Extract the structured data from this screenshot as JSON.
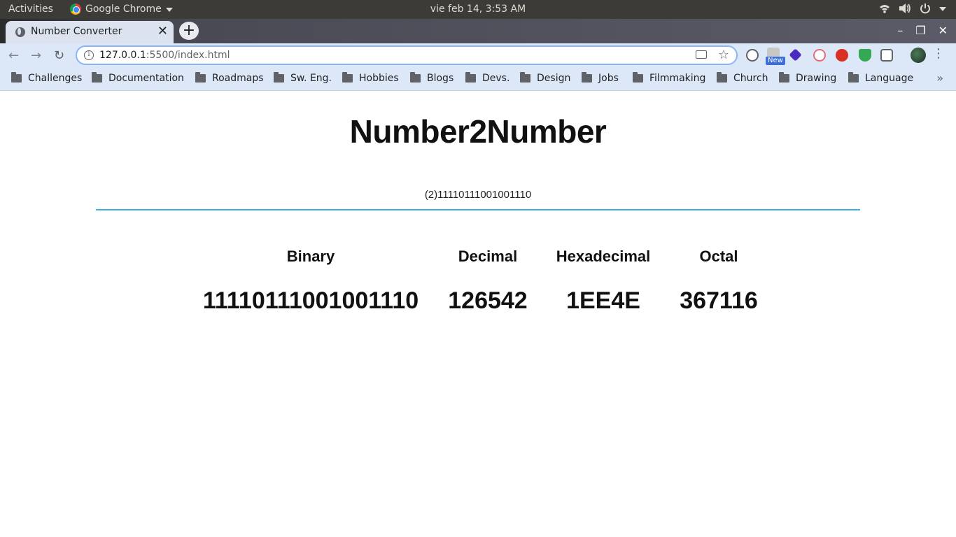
{
  "system_bar": {
    "activities": "Activities",
    "app_name": "Google Chrome",
    "clock": "vie feb 14,  3:53 AM"
  },
  "browser": {
    "tab_title": "Number Converter",
    "url_host": "127.0.0.1",
    "url_rest": ":5500/index.html",
    "new_badge": "New",
    "bookmarks": [
      "Challenges",
      "Documentation",
      "Roadmaps",
      "Sw. Eng.",
      "Hobbies",
      "Blogs",
      "Devs.",
      "Design",
      "Jobs",
      "Filmmaking",
      "Church",
      "Drawing",
      "Language"
    ]
  },
  "page": {
    "title": "Number2Number",
    "input_value": "(2)1111011100100111​0",
    "columns": [
      {
        "label": "Binary",
        "value": "11110111001001110"
      },
      {
        "label": "Decimal",
        "value": "126542"
      },
      {
        "label": "Hexadecimal",
        "value": "1EE4E"
      },
      {
        "label": "Octal",
        "value": "367116"
      }
    ]
  }
}
